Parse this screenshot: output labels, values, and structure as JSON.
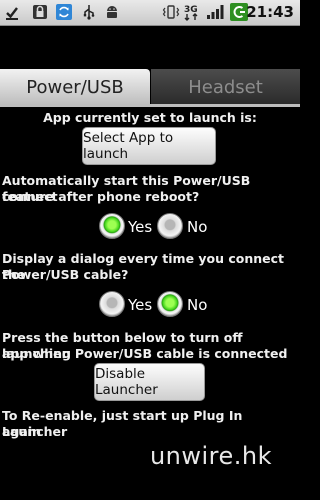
{
  "status_bar": {
    "time": "21:43",
    "network_type": "3G",
    "icons": [
      "download-done-icon",
      "lock-icon",
      "sync-icon",
      "usb-icon",
      "android-icon",
      "vibrate-icon",
      "signal-icon",
      "battery-charging-icon"
    ]
  },
  "tabs": [
    {
      "label": "Power/USB",
      "selected": true
    },
    {
      "label": "Headset",
      "selected": false
    }
  ],
  "launch": {
    "heading": "App currently set to launch is:",
    "button_label": "Select App to launch"
  },
  "auto_start": {
    "question_line1": "Automatically start this Power/USB connect",
    "question_line2": "feature after phone reboot?",
    "yes_label": "Yes",
    "no_label": "No",
    "selected": "Yes"
  },
  "dialog_option": {
    "question_line1": "Display a dialog every time you connect the",
    "question_line2": "Power/USB cable?",
    "yes_label": "Yes",
    "no_label": "No",
    "selected": "No"
  },
  "disable": {
    "text_line1": "Press the button below to turn off launching",
    "text_line2": "app when Power/USB cable is connected",
    "button_label": "Disable Launcher"
  },
  "reenable": {
    "text_line1": "To Re-enable, just start up Plug In Launcher",
    "text_line2": "again"
  },
  "watermark": "unwire.hk",
  "colors": {
    "background": "#000000",
    "radio_selected": "#44d51c",
    "tab_selected": "#e0e0e0",
    "tab_unselected": "#3a3a3a"
  }
}
